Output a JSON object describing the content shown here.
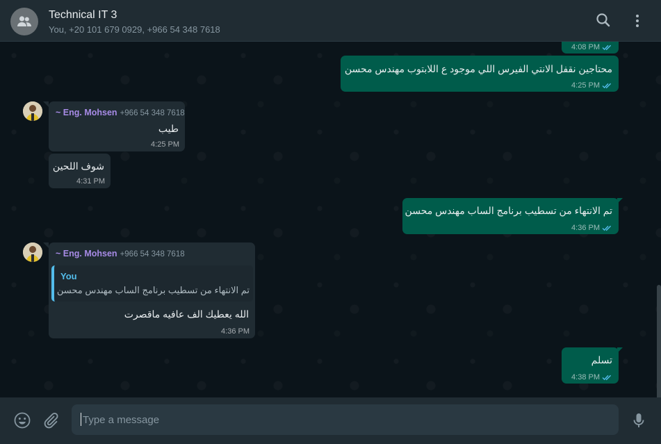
{
  "header": {
    "title": "Technical IT 3",
    "subtitle": "You, +20 101 679 0929, +966 54 348 7618",
    "avatar_icon": "group-icon",
    "search_icon": "search-icon",
    "menu_icon": "menu-icon"
  },
  "messages": [
    {
      "dir": "out",
      "time": "4:08 PM",
      "status": "read"
    },
    {
      "dir": "out",
      "text": "محتاجين نقفل الانتي الفيرس اللي موجود ع اللابتوب مهندس محسن",
      "time": "4:25 PM",
      "status": "read"
    },
    {
      "dir": "in",
      "sender": "~ Eng. Mohsen",
      "phone": "+966 54 348 7618",
      "text": "طيب",
      "time": "4:25 PM"
    },
    {
      "dir": "in",
      "text": "شوف اللحين",
      "time": "4:31 PM"
    },
    {
      "dir": "out",
      "text": "تم الانتهاء من تسطيب برنامج الساب مهندس محسن",
      "time": "4:36 PM",
      "status": "read"
    },
    {
      "dir": "in",
      "sender": "~ Eng. Mohsen",
      "phone": "+966 54 348 7618",
      "quote": {
        "author": "You",
        "text": "تم الانتهاء من تسطيب برنامج الساب مهندس محسن"
      },
      "text": "الله يعطيك الف عافيه ماقصرت",
      "time": "4:36 PM"
    },
    {
      "dir": "out",
      "text": "تسلم",
      "time": "4:38 PM",
      "status": "read"
    }
  ],
  "composer": {
    "placeholder": "Type a message",
    "emoji_icon": "emoji-icon",
    "attach_icon": "paperclip-icon",
    "mic_icon": "microphone-icon"
  },
  "colors": {
    "outgoing_bubble": "#005c4b",
    "incoming_bubble": "#202c33",
    "read_ticks": "#53bdeb",
    "sender_name": "#a78be6",
    "background": "#0b141a"
  }
}
